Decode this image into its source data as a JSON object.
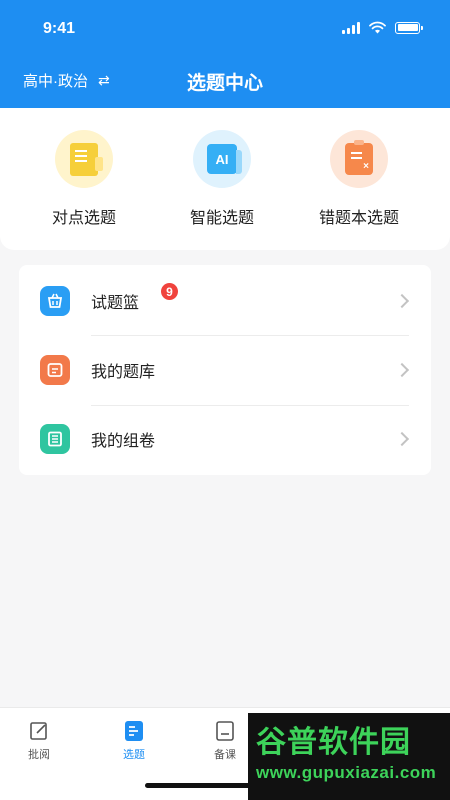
{
  "status": {
    "time": "9:41"
  },
  "header": {
    "subject": "高中·政治",
    "swap_icon": "⇄",
    "title": "选题中心",
    "color": "#1e8ef2"
  },
  "quick_actions": [
    {
      "label": "对点选题",
      "icon": "document-icon",
      "color": "#f6cf3a"
    },
    {
      "label": "智能选题",
      "icon": "ai-icon",
      "color": "#35aff5"
    },
    {
      "label": "错题本选题",
      "icon": "clipboard-x-icon",
      "color": "#f6884b"
    }
  ],
  "list": [
    {
      "label": "试题篮",
      "badge": "9",
      "icon": "basket-icon",
      "color": "#2a9ef4"
    },
    {
      "label": "我的题库",
      "icon": "folder-icon",
      "color": "#f2794a"
    },
    {
      "label": "我的组卷",
      "icon": "paper-list-icon",
      "color": "#2fc5a0"
    }
  ],
  "tabs": [
    {
      "label": "批阅",
      "icon": "edit-icon",
      "active": false
    },
    {
      "label": "选题",
      "icon": "doc-tab-icon",
      "active": true
    },
    {
      "label": "备课",
      "icon": "book-icon",
      "active": false
    },
    {
      "label": "",
      "icon": "chart-icon",
      "active": false
    },
    {
      "label": "",
      "icon": "smile-icon",
      "active": false
    }
  ],
  "watermark": {
    "main": "谷普软件园",
    "sub": "www.gupuxiazai.com"
  }
}
